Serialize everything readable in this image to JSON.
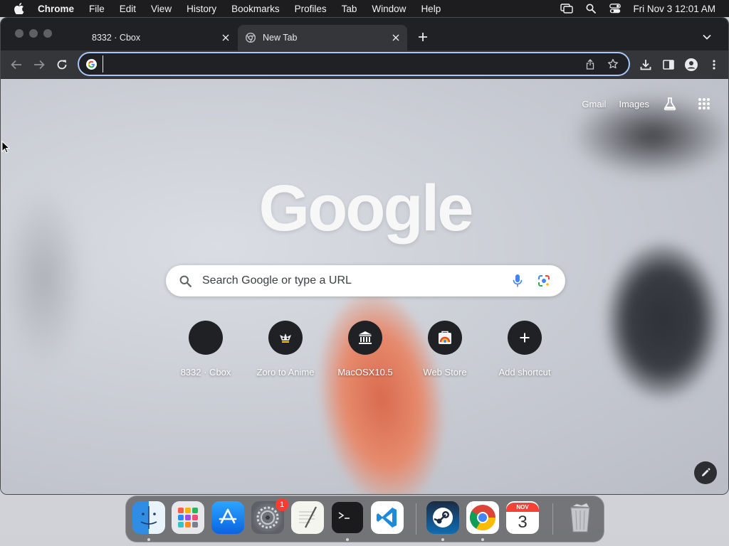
{
  "menubar": {
    "app_name": "Chrome",
    "menus": [
      "File",
      "Edit",
      "View",
      "History",
      "Bookmarks",
      "Profiles",
      "Tab",
      "Window",
      "Help"
    ],
    "clock": "Fri Nov 3  12:01 AM",
    "icons": [
      "apple-icon",
      "screen-mirroring-icon",
      "spotlight-search-icon",
      "control-center-icon"
    ]
  },
  "browser": {
    "tabs": [
      {
        "title": "8332 · Cbox",
        "active": false
      },
      {
        "title": "New Tab",
        "active": true
      }
    ],
    "omnibox": {
      "value": "",
      "placeholder": ""
    }
  },
  "ntp": {
    "links": {
      "gmail": "Gmail",
      "images": "Images"
    },
    "logo": "Google",
    "search_placeholder": "Search Google or type a URL",
    "shortcuts": [
      {
        "label": "8332 · Cbox"
      },
      {
        "label": "Zoro to Anime"
      },
      {
        "label": "MacOSX10.5"
      },
      {
        "label": "Web Store"
      },
      {
        "label": "Add shortcut"
      }
    ]
  },
  "dock": {
    "apps": [
      "Finder",
      "Launchpad",
      "App Store",
      "System Settings",
      "TextEdit",
      "Terminal",
      "Visual Studio Code",
      "Steam",
      "Google Chrome",
      "Calendar",
      "Trash"
    ],
    "system_settings_badge": "1",
    "calendar": {
      "month": "NOV",
      "day": "3"
    }
  },
  "colors": {
    "menubar_bg": "#1d1d20",
    "tabstrip_bg": "#202124",
    "toolbar_bg": "#35363a",
    "omnibox_focus": "#a8c7fa",
    "shortcut_circle": "#202124"
  }
}
